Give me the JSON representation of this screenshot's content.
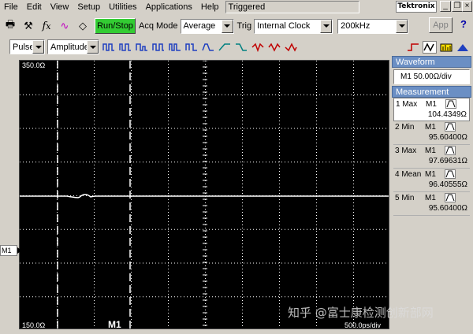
{
  "menu": [
    "File",
    "Edit",
    "View",
    "Setup",
    "Utilities",
    "Applications",
    "Help"
  ],
  "status_text": "Triggered",
  "brand": "Tektronix",
  "toolbar": {
    "run_stop": "Run/Stop",
    "acq_mode_label": "Acq Mode",
    "acq_mode_value": "Average",
    "trig_label": "Trig",
    "trig_value": "Internal Clock",
    "freq_value": "200kHz",
    "app_button": "App",
    "help": "?"
  },
  "toolbar2": {
    "pulse_value": "Pulse",
    "amplitude_value": "Amplitude"
  },
  "display": {
    "top_label": "350.0Ω",
    "bottom_label": "150.0Ω",
    "time_label": "500.0ps/div",
    "cursor_label": "M1",
    "marker_label": "M1"
  },
  "panel": {
    "waveform_header": "Waveform",
    "waveform_value": "M1 50.00Ω/div",
    "measurement_header": "Measurement",
    "measurements": [
      {
        "name": "1 Max",
        "src": "M1",
        "value": "104.4349Ω"
      },
      {
        "name": "2 Min",
        "src": "M1",
        "value": "95.60400Ω"
      },
      {
        "name": "3 Max",
        "src": "M1",
        "value": "97.69631Ω"
      },
      {
        "name": "4 Mean",
        "src": "M1",
        "value": "96.40555Ω"
      },
      {
        "name": "5 Min",
        "src": "M1",
        "value": "95.60400Ω"
      }
    ]
  },
  "watermark": "知乎 @富士康检测创新部网",
  "colors": {
    "run_stop": "#33cc33",
    "panel_header": "#6b8fc4",
    "trace": "#ffffff",
    "grid": "#ffffff"
  }
}
